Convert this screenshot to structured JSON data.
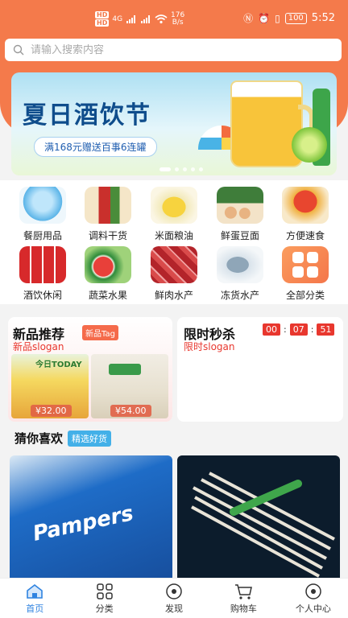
{
  "status_bar": {
    "network": "4G",
    "speed_value": "176",
    "speed_unit": "B/s",
    "battery": "100",
    "time": "5:52"
  },
  "search": {
    "placeholder": "请输入搜索内容"
  },
  "banner": {
    "title": "夏日酒饮节",
    "subtitle": "满168元赠送百事6连罐",
    "slide_count": 5,
    "active_slide": 1
  },
  "categories": [
    {
      "label": "餐厨用品",
      "icon": "water-jug-icon"
    },
    {
      "label": "调料干货",
      "icon": "sauce-bottle-icon"
    },
    {
      "label": "米面粮油",
      "icon": "oil-bottle-icon"
    },
    {
      "label": "鲜蛋豆面",
      "icon": "eggs-icon"
    },
    {
      "label": "方便速食",
      "icon": "crab-icon"
    },
    {
      "label": "酒饮休闲",
      "icon": "beer-cans-icon"
    },
    {
      "label": "蔬菜水果",
      "icon": "watermelon-icon"
    },
    {
      "label": "鲜肉水产",
      "icon": "meat-icon"
    },
    {
      "label": "冻货水产",
      "icon": "fish-icon"
    },
    {
      "label": "全部分类",
      "icon": "grid-icon"
    }
  ],
  "new_products": {
    "title": "新品推荐",
    "tag": "新品Tag",
    "slogan": "新品slogan",
    "items": [
      {
        "price": "¥32.00",
        "label": "今日TODAY"
      },
      {
        "price": "¥54.00",
        "label": ""
      }
    ]
  },
  "flash_sale": {
    "title": "限时秒杀",
    "slogan": "限时slogan",
    "countdown": {
      "hours": "00",
      "minutes": "07",
      "seconds": "51"
    }
  },
  "guess": {
    "title": "猜你喜欢",
    "tag": "精选好货"
  },
  "feed": [
    {
      "brand": "Pampers"
    },
    {
      "brand": ""
    }
  ],
  "tabbar": [
    {
      "label": "首页",
      "icon": "home-icon",
      "active": true
    },
    {
      "label": "分类",
      "icon": "category-grid-icon",
      "active": false
    },
    {
      "label": "发现",
      "icon": "discover-icon",
      "active": false
    },
    {
      "label": "购物车",
      "icon": "cart-icon",
      "active": false
    },
    {
      "label": "个人中心",
      "icon": "profile-icon",
      "active": false
    }
  ],
  "colors": {
    "brand": "#f47a4b",
    "accent_blue": "#2f83e0",
    "price_red": "#e8372e",
    "tag_blue": "#43b0e8"
  }
}
